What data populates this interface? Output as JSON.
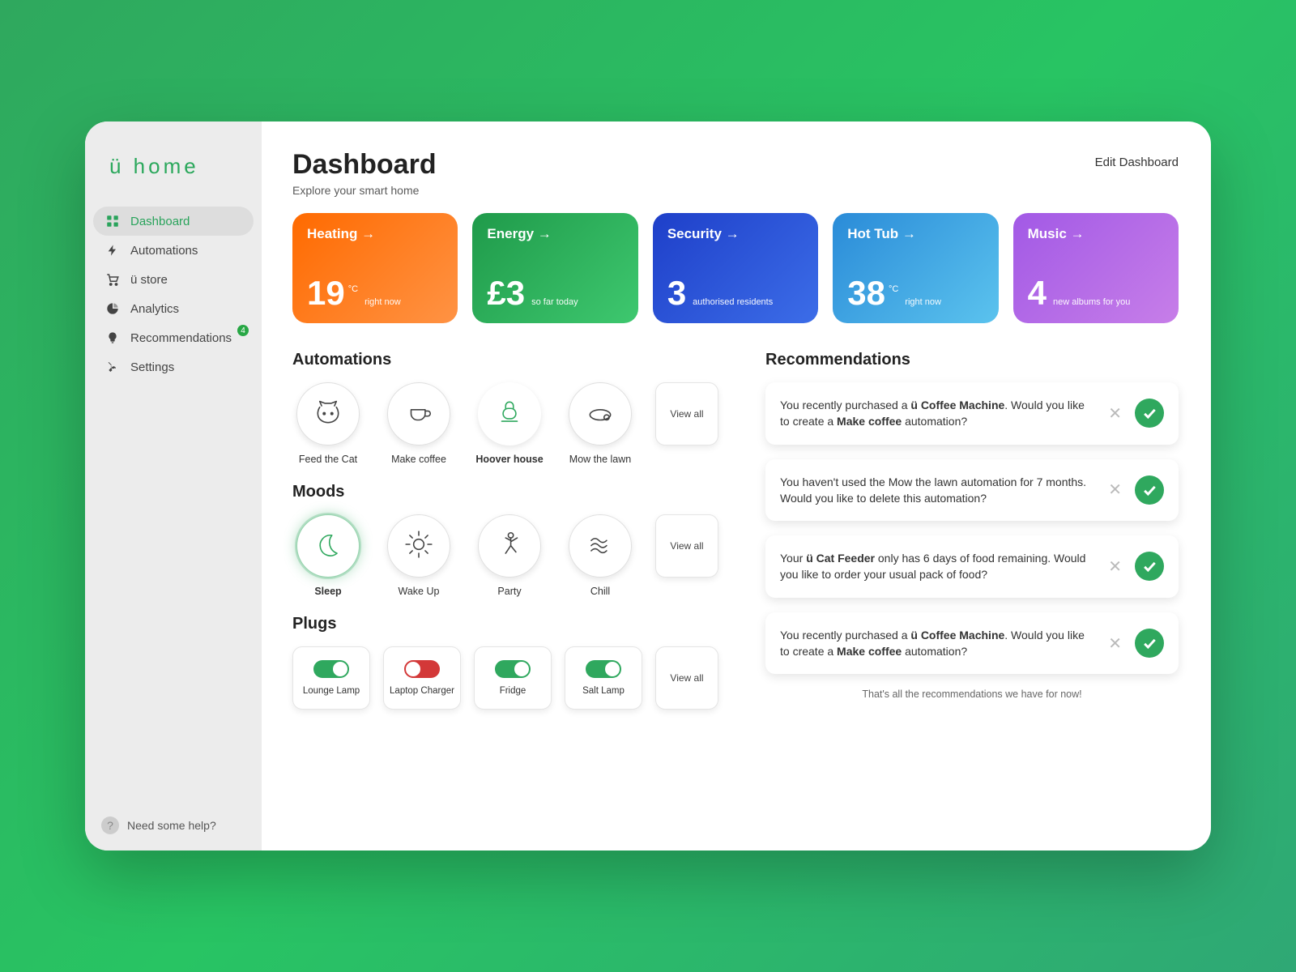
{
  "brand": "ü home",
  "sidebar": {
    "items": [
      {
        "label": "Dashboard",
        "icon": "dashboard-icon",
        "active": true
      },
      {
        "label": "Automations",
        "icon": "bolt-icon"
      },
      {
        "label": "ü store",
        "icon": "cart-icon"
      },
      {
        "label": "Analytics",
        "icon": "pie-icon"
      },
      {
        "label": "Recommendations",
        "icon": "bulb-icon",
        "badge": "4"
      },
      {
        "label": "Settings",
        "icon": "wrench-icon"
      }
    ],
    "help": "Need some help?"
  },
  "header": {
    "title": "Dashboard",
    "subtitle": "Explore your smart home",
    "edit": "Edit Dashboard"
  },
  "cards": [
    {
      "key": "heating",
      "title": "Heating",
      "value": "19",
      "unit": "°C",
      "sub": "right now"
    },
    {
      "key": "energy",
      "title": "Energy",
      "value": "£3",
      "unit": "",
      "sub": "so far today"
    },
    {
      "key": "security",
      "title": "Security",
      "value": "3",
      "unit": "",
      "sub": "authorised residents"
    },
    {
      "key": "hottub",
      "title": "Hot Tub",
      "value": "38",
      "unit": "°C",
      "sub": "right now"
    },
    {
      "key": "music",
      "title": "Music",
      "value": "4",
      "unit": "",
      "sub": "new albums for you"
    }
  ],
  "automations": {
    "title": "Automations",
    "items": [
      {
        "label": "Feed the Cat",
        "icon": "cat"
      },
      {
        "label": "Make coffee",
        "icon": "coffee"
      },
      {
        "label": "Hoover house",
        "icon": "vacuum",
        "active": true
      },
      {
        "label": "Mow the lawn",
        "icon": "mower"
      }
    ],
    "view_all": "View all"
  },
  "moods": {
    "title": "Moods",
    "items": [
      {
        "label": "Sleep",
        "icon": "moon",
        "active": true
      },
      {
        "label": "Wake Up",
        "icon": "sun"
      },
      {
        "label": "Party",
        "icon": "dance"
      },
      {
        "label": "Chill",
        "icon": "waves"
      }
    ],
    "view_all": "View all"
  },
  "plugs": {
    "title": "Plugs",
    "items": [
      {
        "label": "Lounge Lamp",
        "on": true
      },
      {
        "label": "Laptop Charger",
        "on": false
      },
      {
        "label": "Fridge",
        "on": true
      },
      {
        "label": "Salt Lamp",
        "on": true
      }
    ],
    "view_all": "View all"
  },
  "recommendations": {
    "title": "Recommendations",
    "items": [
      {
        "html": "You recently purchased a <b>ü Coffee Machine</b>. Would you like to create a <b>Make coffee</b> automation?"
      },
      {
        "html": "You haven't used the Mow the lawn automation for 7 months. Would you like to delete this automation?"
      },
      {
        "html": "Your <b>ü Cat Feeder</b> only has 6 days of food remaining. Would you like to order your usual pack of food?"
      },
      {
        "html": "You recently purchased a <b>ü Coffee Machine</b>. Would you like to create a <b>Make coffee</b> automation?"
      }
    ],
    "footer": "That's all the recommendations we have for now!"
  }
}
